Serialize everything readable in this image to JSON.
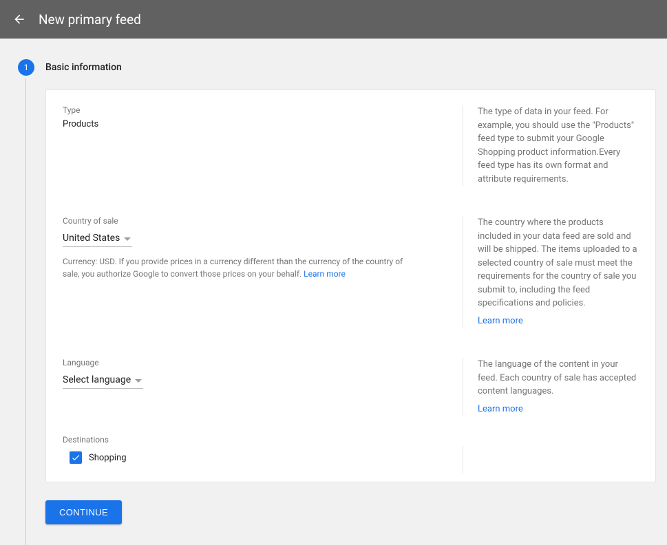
{
  "header": {
    "title": "New primary feed"
  },
  "step": {
    "number": "1",
    "title": "Basic information"
  },
  "type": {
    "label": "Type",
    "value": "Products",
    "description": "The type of data in your feed. For example, you should use the \"Products\" feed type to submit your Google Shopping product information.Every feed type has its own format and attribute requirements."
  },
  "country": {
    "label": "Country of sale",
    "value": "United States",
    "helper_prefix": "Currency: USD. If you provide prices in a currency different than the currency of the country of sale, you authorize Google to convert those prices on your behalf. ",
    "helper_link": "Learn more",
    "description": "The country where the products included in your data feed are sold and will be shipped. The items uploaded to a selected country of sale must meet the requirements for the country of sale you submit to, including the feed specifications and policies.",
    "desc_link": "Learn more"
  },
  "language": {
    "label": "Language",
    "value": "Select language",
    "description": "The language of the content in your feed. Each country of sale has accepted content languages.",
    "desc_link": "Learn more"
  },
  "destinations": {
    "label": "Destinations",
    "items": [
      {
        "label": "Shopping",
        "checked": true
      }
    ]
  },
  "actions": {
    "continue": "CONTINUE"
  }
}
